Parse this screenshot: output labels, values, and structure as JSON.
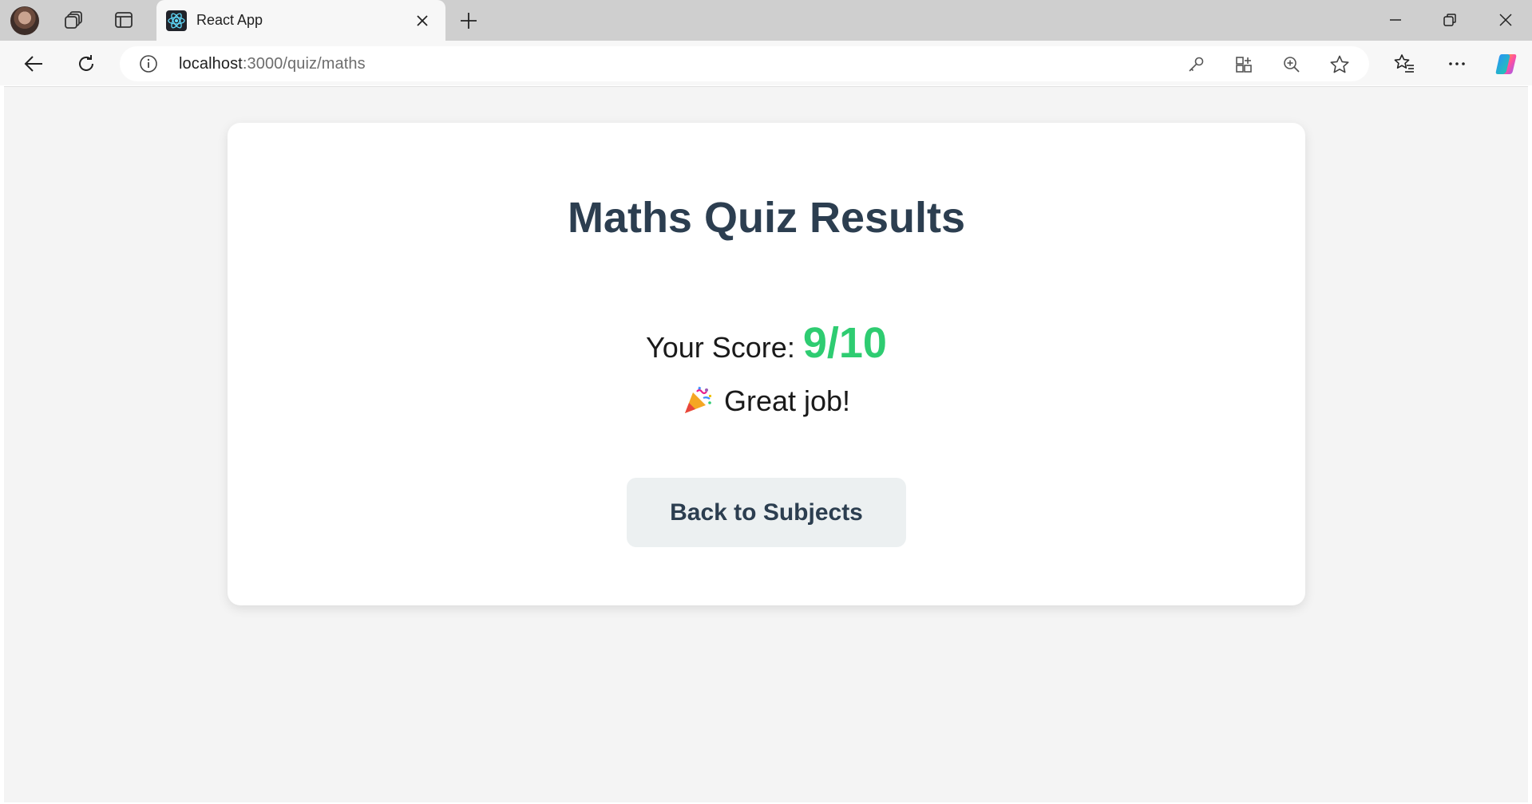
{
  "browser": {
    "tab": {
      "title": "React App"
    },
    "url": {
      "host": "localhost",
      "path": ":3000/quiz/maths"
    }
  },
  "quiz": {
    "title": "Maths Quiz Results",
    "score_label": "Your Score:",
    "score_value": "9/10",
    "message": "Great job!",
    "back_button": "Back to Subjects"
  },
  "colors": {
    "title": "#2c3e50",
    "score": "#2ecc71",
    "button_bg": "#ecf0f1",
    "page_bg": "#f4f4f4"
  },
  "icons": [
    "profile-avatar",
    "workspaces-icon",
    "tab-actions-icon",
    "react-favicon",
    "close-icon",
    "plus-icon",
    "minimize-icon",
    "restore-icon",
    "window-close-icon",
    "back-arrow-icon",
    "refresh-icon",
    "info-icon",
    "key-icon",
    "apps-icon",
    "zoom-in-icon",
    "star-icon",
    "favorites-icon",
    "more-icon",
    "copilot-icon",
    "party-popper-icon"
  ]
}
